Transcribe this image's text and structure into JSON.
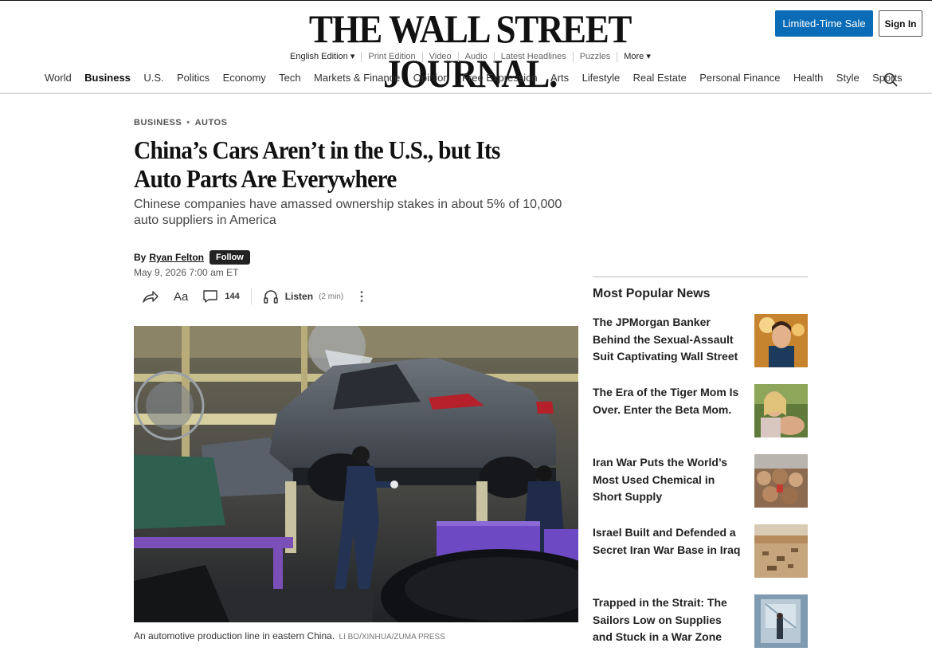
{
  "masthead": {
    "logo": "THE WALL STREET JOURNAL.",
    "sale_button": "Limited-Time Sale",
    "signin_button": "Sign In"
  },
  "utility_nav": [
    {
      "label": "English Edition ▾"
    },
    {
      "label": "Print Edition"
    },
    {
      "label": "Video"
    },
    {
      "label": "Audio"
    },
    {
      "label": "Latest Headlines"
    },
    {
      "label": "Puzzles"
    },
    {
      "label": "More ▾"
    }
  ],
  "main_nav": [
    {
      "label": "World"
    },
    {
      "label": "Business",
      "active": true
    },
    {
      "label": "U.S."
    },
    {
      "label": "Politics"
    },
    {
      "label": "Economy"
    },
    {
      "label": "Tech"
    },
    {
      "label": "Markets & Finance"
    },
    {
      "label": "Opinion"
    },
    {
      "label": "Free Expression"
    },
    {
      "label": "Arts"
    },
    {
      "label": "Lifestyle"
    },
    {
      "label": "Real Estate"
    },
    {
      "label": "Personal Finance"
    },
    {
      "label": "Health"
    },
    {
      "label": "Style"
    },
    {
      "label": "Sports"
    }
  ],
  "article": {
    "crumb_section": "BUSINESS",
    "crumb_sub": "AUTOS",
    "headline": "China’s Cars Aren’t in the U.S., but Its Auto Parts Are Everywhere",
    "dek": "Chinese companies have amassed ownership stakes in about 5% of 10,000 auto suppliers in America",
    "byline_prefix": "By",
    "author": "Ryan Felton",
    "follow_label": "Follow",
    "date": "May 9, 2026 7:00 am ET",
    "comment_count": "144",
    "listen_label": "Listen",
    "listen_duration": "(2 min)",
    "font_tool_label": "Aa",
    "caption": "An automotive production line in eastern China.",
    "credit": "LI BO/XINHUA/ZUMA PRESS"
  },
  "sidebar": {
    "title": "Most Popular News",
    "items": [
      {
        "title": "The JPMorgan Banker Behind the Sexual-Assault Suit Captivating Wall Street"
      },
      {
        "title": "The Era of the Tiger Mom Is Over. Enter the Beta Mom."
      },
      {
        "title": "Iran War Puts the World’s Most Used Chemical in Short Supply"
      },
      {
        "title": "Israel Built and Defended a Secret Iran War Base in Iraq"
      },
      {
        "title": "Trapped in the Strait: The Sailors Low on Supplies and Stuck in a War Zone"
      }
    ]
  },
  "colors": {
    "sale_blue": "#0a6bb6",
    "text": "#111111"
  }
}
